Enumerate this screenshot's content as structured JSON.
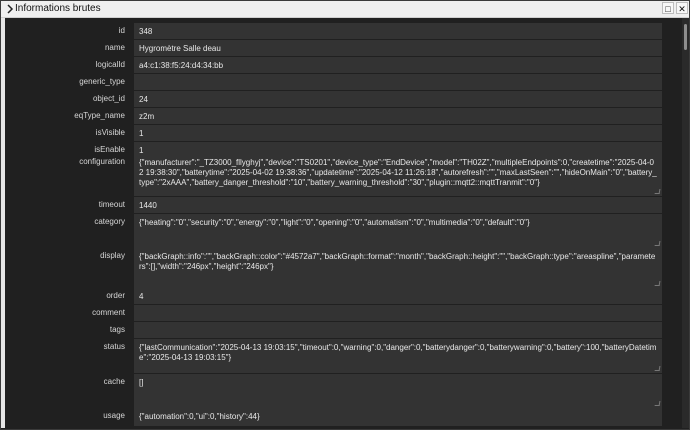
{
  "window": {
    "title": "Informations brutes",
    "restore_icon": "restore-icon",
    "close_icon": "close-icon",
    "restore_glyph": "□",
    "close_glyph": "✕"
  },
  "fields": [
    {
      "key": "id",
      "label": "id",
      "value": "348"
    },
    {
      "key": "name",
      "label": "name",
      "value": "Hygromètre Salle deau"
    },
    {
      "key": "logicalId",
      "label": "logicalId",
      "value": "a4:c1:38:f5:24:d4:34:bb"
    },
    {
      "key": "generic_type",
      "label": "generic_type",
      "value": ""
    },
    {
      "key": "object_id",
      "label": "object_id",
      "value": "24"
    },
    {
      "key": "eqType_name",
      "label": "eqType_name",
      "value": "z2m"
    },
    {
      "key": "isVisible",
      "label": "isVisible",
      "value": "1"
    },
    {
      "key": "isEnable",
      "label": "isEnable",
      "value": "1"
    },
    {
      "key": "configuration",
      "label": "configuration",
      "value": "{\"manufacturer\":\"_TZ3000_fllyghyj\",\"device\":\"TS0201\",\"device_type\":\"EndDevice\",\"model\":\"TH02Z\",\"multipleEndpoints\":0,\"createtime\":\"2025-04-02 19:38:30\",\"batterytime\":\"2025-04-02 19:38:36\",\"updatetime\":\"2025-04-12 11:26:18\",\"autorefresh\":\"\",\"maxLastSeen\":\"\",\"hideOnMain\":\"0\",\"battery_type\":\"2xAAA\",\"battery_danger_threshold\":\"10\",\"battery_warning_threshold\":\"30\",\"plugin::mqtt2::mqttTranmit\":\"0\"}"
    },
    {
      "key": "timeout",
      "label": "timeout",
      "value": "1440"
    },
    {
      "key": "category",
      "label": "category",
      "value": "{\"heating\":\"0\",\"security\":\"0\",\"energy\":\"0\",\"light\":\"0\",\"opening\":\"0\",\"automatism\":\"0\",\"multimedia\":\"0\",\"default\":\"0\"}"
    },
    {
      "key": "display",
      "label": "display",
      "value": "{\"backGraph::info\":\"\",\"backGraph::color\":\"#4572a7\",\"backGraph::format\":\"month\",\"backGraph::height\":\"\",\"backGraph::type\":\"areaspline\",\"parameters\":[],\"width\":\"246px\",\"height\":\"246px\"}"
    },
    {
      "key": "order",
      "label": "order",
      "value": "4"
    },
    {
      "key": "comment",
      "label": "comment",
      "value": ""
    },
    {
      "key": "tags",
      "label": "tags",
      "value": ""
    },
    {
      "key": "status",
      "label": "status",
      "value": "{\"lastCommunication\":\"2025-04-13 19:03:15\",\"timeout\":0,\"warning\":0,\"danger\":0,\"batterydanger\":0,\"batterywarning\":0,\"battery\":100,\"batteryDatetime\":\"2025-04-13 19:03:15\"}"
    },
    {
      "key": "cache",
      "label": "cache",
      "value": "[]"
    },
    {
      "key": "usage",
      "label": "usage",
      "value": "{\"automation\":0,\"ui\":0,\"history\":44}"
    }
  ],
  "colors": {
    "background": "#202020",
    "field_bg": "#333333",
    "text": "#e8e8e8",
    "label": "#d6d6d6",
    "titlebar": "#efefef"
  }
}
